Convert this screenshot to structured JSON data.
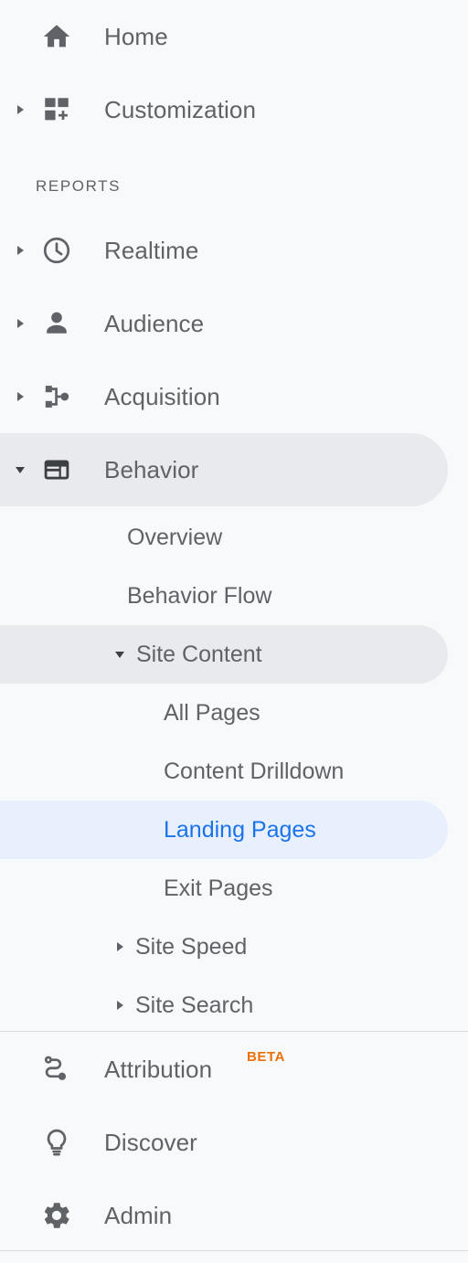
{
  "colors": {
    "background": "#f8f9fa",
    "text": "#5f6368",
    "selected_blue_text": "#1a73e8",
    "selected_blue_bg": "#e8f0fe",
    "selected_grey_bg": "#e8eaed",
    "beta_orange": "#e8710a",
    "divider": "#dadce0",
    "icon_dark": "#3c4043"
  },
  "nav": {
    "home": {
      "label": "Home",
      "icon": "home-icon"
    },
    "customization": {
      "label": "Customization",
      "icon": "customization-grid-icon",
      "caret": "chevron-right-icon"
    },
    "reports_header": "REPORTS",
    "realtime": {
      "label": "Realtime",
      "icon": "clock-icon",
      "caret": "chevron-right-icon"
    },
    "audience": {
      "label": "Audience",
      "icon": "person-icon",
      "caret": "chevron-right-icon"
    },
    "acquisition": {
      "label": "Acquisition",
      "icon": "acquisition-nodes-icon",
      "caret": "chevron-right-icon"
    },
    "behavior": {
      "label": "Behavior",
      "icon": "behavior-layout-icon",
      "caret": "chevron-down-icon"
    },
    "attribution": {
      "label": "Attribution",
      "badge": "BETA",
      "icon": "attribution-path-icon"
    },
    "discover": {
      "label": "Discover",
      "icon": "lightbulb-icon"
    },
    "admin": {
      "label": "Admin",
      "icon": "gear-icon"
    }
  },
  "behavior_submenu": [
    {
      "label": "Overview",
      "level": 1,
      "state": "normal"
    },
    {
      "label": "Behavior Flow",
      "level": 1,
      "state": "normal"
    },
    {
      "label": "Site Content",
      "level": 1,
      "state": "expanded-selected",
      "caret": "chevron-down-icon"
    },
    {
      "label": "All Pages",
      "level": 2,
      "state": "normal"
    },
    {
      "label": "Content Drilldown",
      "level": 2,
      "state": "normal"
    },
    {
      "label": "Landing Pages",
      "level": 2,
      "state": "active"
    },
    {
      "label": "Exit Pages",
      "level": 2,
      "state": "normal"
    },
    {
      "label": "Site Speed",
      "level": 1,
      "state": "collapsed",
      "caret": "chevron-right-icon"
    },
    {
      "label": "Site Search",
      "level": 1,
      "state": "collapsed",
      "caret": "chevron-right-icon"
    }
  ]
}
